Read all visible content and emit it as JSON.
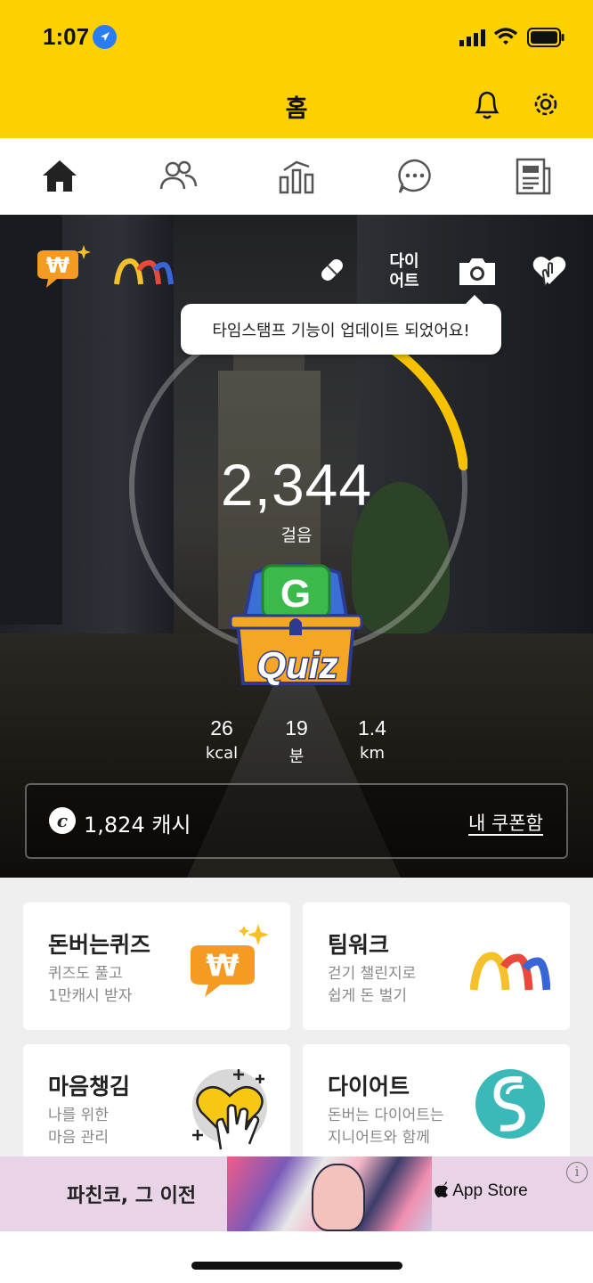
{
  "status": {
    "time": "1:07"
  },
  "header": {
    "title": "홈"
  },
  "nav": {
    "items": [
      "home",
      "friends",
      "stats",
      "chat",
      "news"
    ]
  },
  "hero": {
    "diet_label": "다이\n어트",
    "tooltip": "타임스탬프 기능이 업데이트 되었어요!",
    "steps": "2,344",
    "steps_unit": "걸음",
    "progress_fraction": 0.23,
    "stats": [
      {
        "value": "26",
        "unit": "kcal"
      },
      {
        "value": "19",
        "unit": "분"
      },
      {
        "value": "1.4",
        "unit": "km"
      }
    ],
    "cash": "1,824 캐시",
    "coupon_label": "내 쿠폰함"
  },
  "cards": [
    {
      "title": "돈버는퀴즈",
      "subtitle": "퀴즈도 풀고\n1만캐시 받자"
    },
    {
      "title": "팀워크",
      "subtitle": "걷기 챌린지로\n쉽게 돈 벌기"
    },
    {
      "title": "마음챙김",
      "subtitle": "나를 위한\n마음 관리"
    },
    {
      "title": "다이어트",
      "subtitle": "돈버는 다이어트는\n지니어트와 함께"
    }
  ],
  "ad": {
    "title": "파친코, 그 이전",
    "store": "App Store",
    "info": "i"
  },
  "colors": {
    "brand": "#fdd100",
    "orange": "#f59a23",
    "teal": "#3bb8b8"
  }
}
